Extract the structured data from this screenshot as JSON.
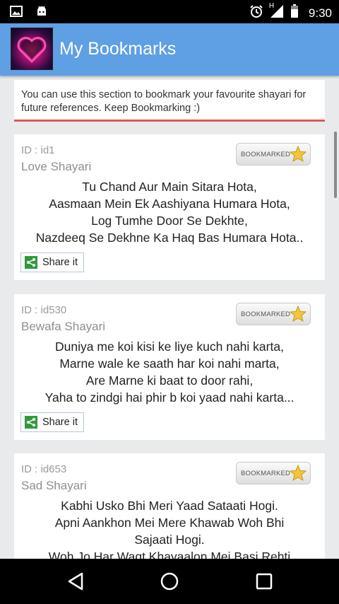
{
  "status_bar": {
    "time": "9:30",
    "network_label": "H",
    "icons": [
      "image-icon",
      "android-icon",
      "alarm-icon",
      "signal-icon",
      "battery-icon"
    ]
  },
  "app_bar": {
    "title": "My Bookmarks",
    "color": "#5f9fe3"
  },
  "info": {
    "text": "You can use this section to bookmark your favourite shayari for future references. Keep Bookmarking :)",
    "accent": "#e25555"
  },
  "bookmark_label": "BOOKMARKED",
  "share_label": "Share it",
  "cards": [
    {
      "id": "ID : id1",
      "category": "Love Shayari",
      "lines": [
        "Tu Chand Aur Main Sitara Hota,",
        "Aasmaan Mein Ek Aashiyana Humara Hota,",
        "Log Tumhe Door Se Dekhte,",
        "Nazdeeq Se Dekhne Ka Haq Bas Humara Hota.."
      ]
    },
    {
      "id": "ID : id530",
      "category": "Bewafa Shayari",
      "lines": [
        "Duniya me koi kisi ke liye kuch nahi karta,",
        "Marne wale ke saath har koi nahi marta,",
        "Are Marne ki baat to door rahi,",
        "Yaha to zindgi hai phir b koi yaad nahi karta..."
      ]
    },
    {
      "id": "ID : id653",
      "category": "Sad Shayari",
      "lines": [
        "Kabhi Usko Bhi Meri Yaad Sataati Hogi.",
        "Apni Aankhon Mei Mere Khawab Woh Bhi",
        "Sajaati Hogi.",
        "Woh Jo Har Waqt Khayaalon Mei Basi Rehti"
      ]
    }
  ]
}
